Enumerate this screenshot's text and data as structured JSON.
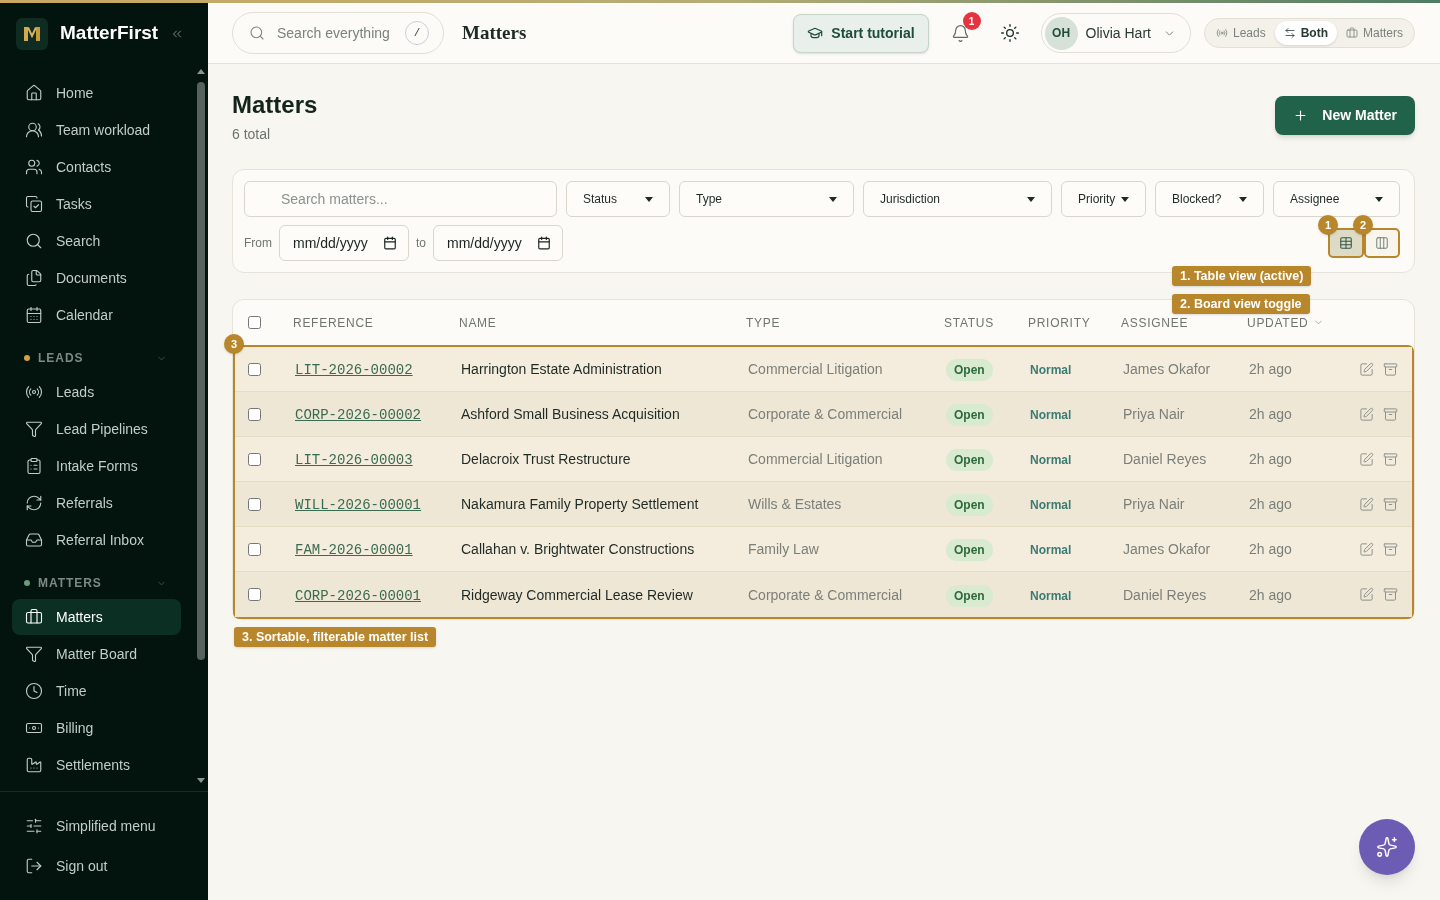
{
  "sidebar": {
    "brand": "MatterFirst",
    "groups": [
      {
        "items": [
          {
            "label": "Home",
            "selected": false
          },
          {
            "label": "Team workload",
            "selected": false
          },
          {
            "label": "Contacts",
            "selected": false
          },
          {
            "label": "Tasks",
            "selected": false
          },
          {
            "label": "Search",
            "selected": false
          },
          {
            "label": "Documents",
            "selected": false
          },
          {
            "label": "Calendar",
            "selected": false
          }
        ]
      },
      {
        "heading": "LEADS",
        "color": "#d1a343",
        "expanded": true,
        "items": [
          {
            "label": "Leads",
            "selected": false
          },
          {
            "label": "Lead Pipelines",
            "selected": false
          },
          {
            "label": "Intake Forms",
            "selected": false
          },
          {
            "label": "Referrals",
            "selected": false
          },
          {
            "label": "Referral Inbox",
            "selected": false
          }
        ]
      },
      {
        "heading": "MATTERS",
        "color": "#6a9c80",
        "expanded": true,
        "items": [
          {
            "label": "Matters",
            "selected": true
          },
          {
            "label": "Matter Board",
            "selected": false
          },
          {
            "label": "Time",
            "selected": false
          },
          {
            "label": "Billing",
            "selected": false
          },
          {
            "label": "Settlements",
            "selected": false
          }
        ]
      }
    ],
    "footer": [
      {
        "label": "Simplified menu"
      },
      {
        "label": "Sign out"
      }
    ]
  },
  "topbar": {
    "search": {
      "placeholder": "Search everything",
      "shortcut": "/"
    },
    "title": "Matters",
    "tutorial_button": "Start tutorial",
    "notification_count": "1",
    "user": {
      "initials": "OH",
      "name": "Olivia Hart"
    },
    "mode_switch": [
      {
        "label": "Leads",
        "selected": false
      },
      {
        "label": "Both",
        "selected": true
      },
      {
        "label": "Matters",
        "selected": false
      }
    ]
  },
  "page_header": {
    "title": "Matters",
    "subtitle": "6 total",
    "new_button": "New Matter"
  },
  "filters": {
    "search": {
      "placeholder": "Search matters..."
    },
    "selects": [
      "Status",
      "Type",
      "Jurisdiction",
      "Priority",
      "Blocked?",
      "Assignee"
    ],
    "date_from": {
      "label": "From",
      "placeholder": "mm/dd/yyyy"
    },
    "date_to": {
      "label": "to",
      "placeholder": "mm/dd/yyyy"
    },
    "view_toggle": [
      {
        "selected": true
      },
      {
        "selected": false
      }
    ]
  },
  "table": {
    "select_all_checked": false,
    "columns": [
      {
        "label": "REFERENCE",
        "sorted": false
      },
      {
        "label": "NAME",
        "sorted": false
      },
      {
        "label": "TYPE",
        "sorted": false
      },
      {
        "label": "STATUS",
        "sorted": false
      },
      {
        "label": "PRIORITY",
        "sorted": false
      },
      {
        "label": "ASSIGNEE",
        "sorted": false
      },
      {
        "label": "UPDATED",
        "sorted": true
      }
    ],
    "rows": [
      {
        "checked": false,
        "reference": "LIT-2026-00002",
        "name": "Harrington Estate Administration",
        "type": "Commercial Litigation",
        "status": "Open",
        "priority": "Normal",
        "assignee": "James Okafor",
        "updated": "2h ago"
      },
      {
        "checked": false,
        "reference": "CORP-2026-00002",
        "name": "Ashford Small Business Acquisition",
        "type": "Corporate & Commercial",
        "status": "Open",
        "priority": "Normal",
        "assignee": "Priya Nair",
        "updated": "2h ago"
      },
      {
        "checked": false,
        "reference": "LIT-2026-00003",
        "name": "Delacroix Trust Restructure",
        "type": "Commercial Litigation",
        "status": "Open",
        "priority": "Normal",
        "assignee": "Daniel Reyes",
        "updated": "2h ago"
      },
      {
        "checked": false,
        "reference": "WILL-2026-00001",
        "name": "Nakamura Family Property Settlement",
        "type": "Wills & Estates",
        "status": "Open",
        "priority": "Normal",
        "assignee": "Priya Nair",
        "updated": "2h ago"
      },
      {
        "checked": false,
        "reference": "FAM-2026-00001",
        "name": "Callahan v. Brightwater Constructions",
        "type": "Family Law",
        "status": "Open",
        "priority": "Normal",
        "assignee": "James Okafor",
        "updated": "2h ago"
      },
      {
        "checked": false,
        "reference": "CORP-2026-00001",
        "name": "Ridgeway Commercial Lease Review",
        "type": "Corporate & Commercial",
        "status": "Open",
        "priority": "Normal",
        "assignee": "Daniel Reyes",
        "updated": "2h ago"
      }
    ]
  },
  "tutorial": {
    "markers": [
      {
        "number": "1",
        "label": "1. Table view (active)"
      },
      {
        "number": "2",
        "label": "2. Board view toggle"
      },
      {
        "number": "3",
        "label": "3. Sortable, filterable matter list"
      }
    ]
  }
}
